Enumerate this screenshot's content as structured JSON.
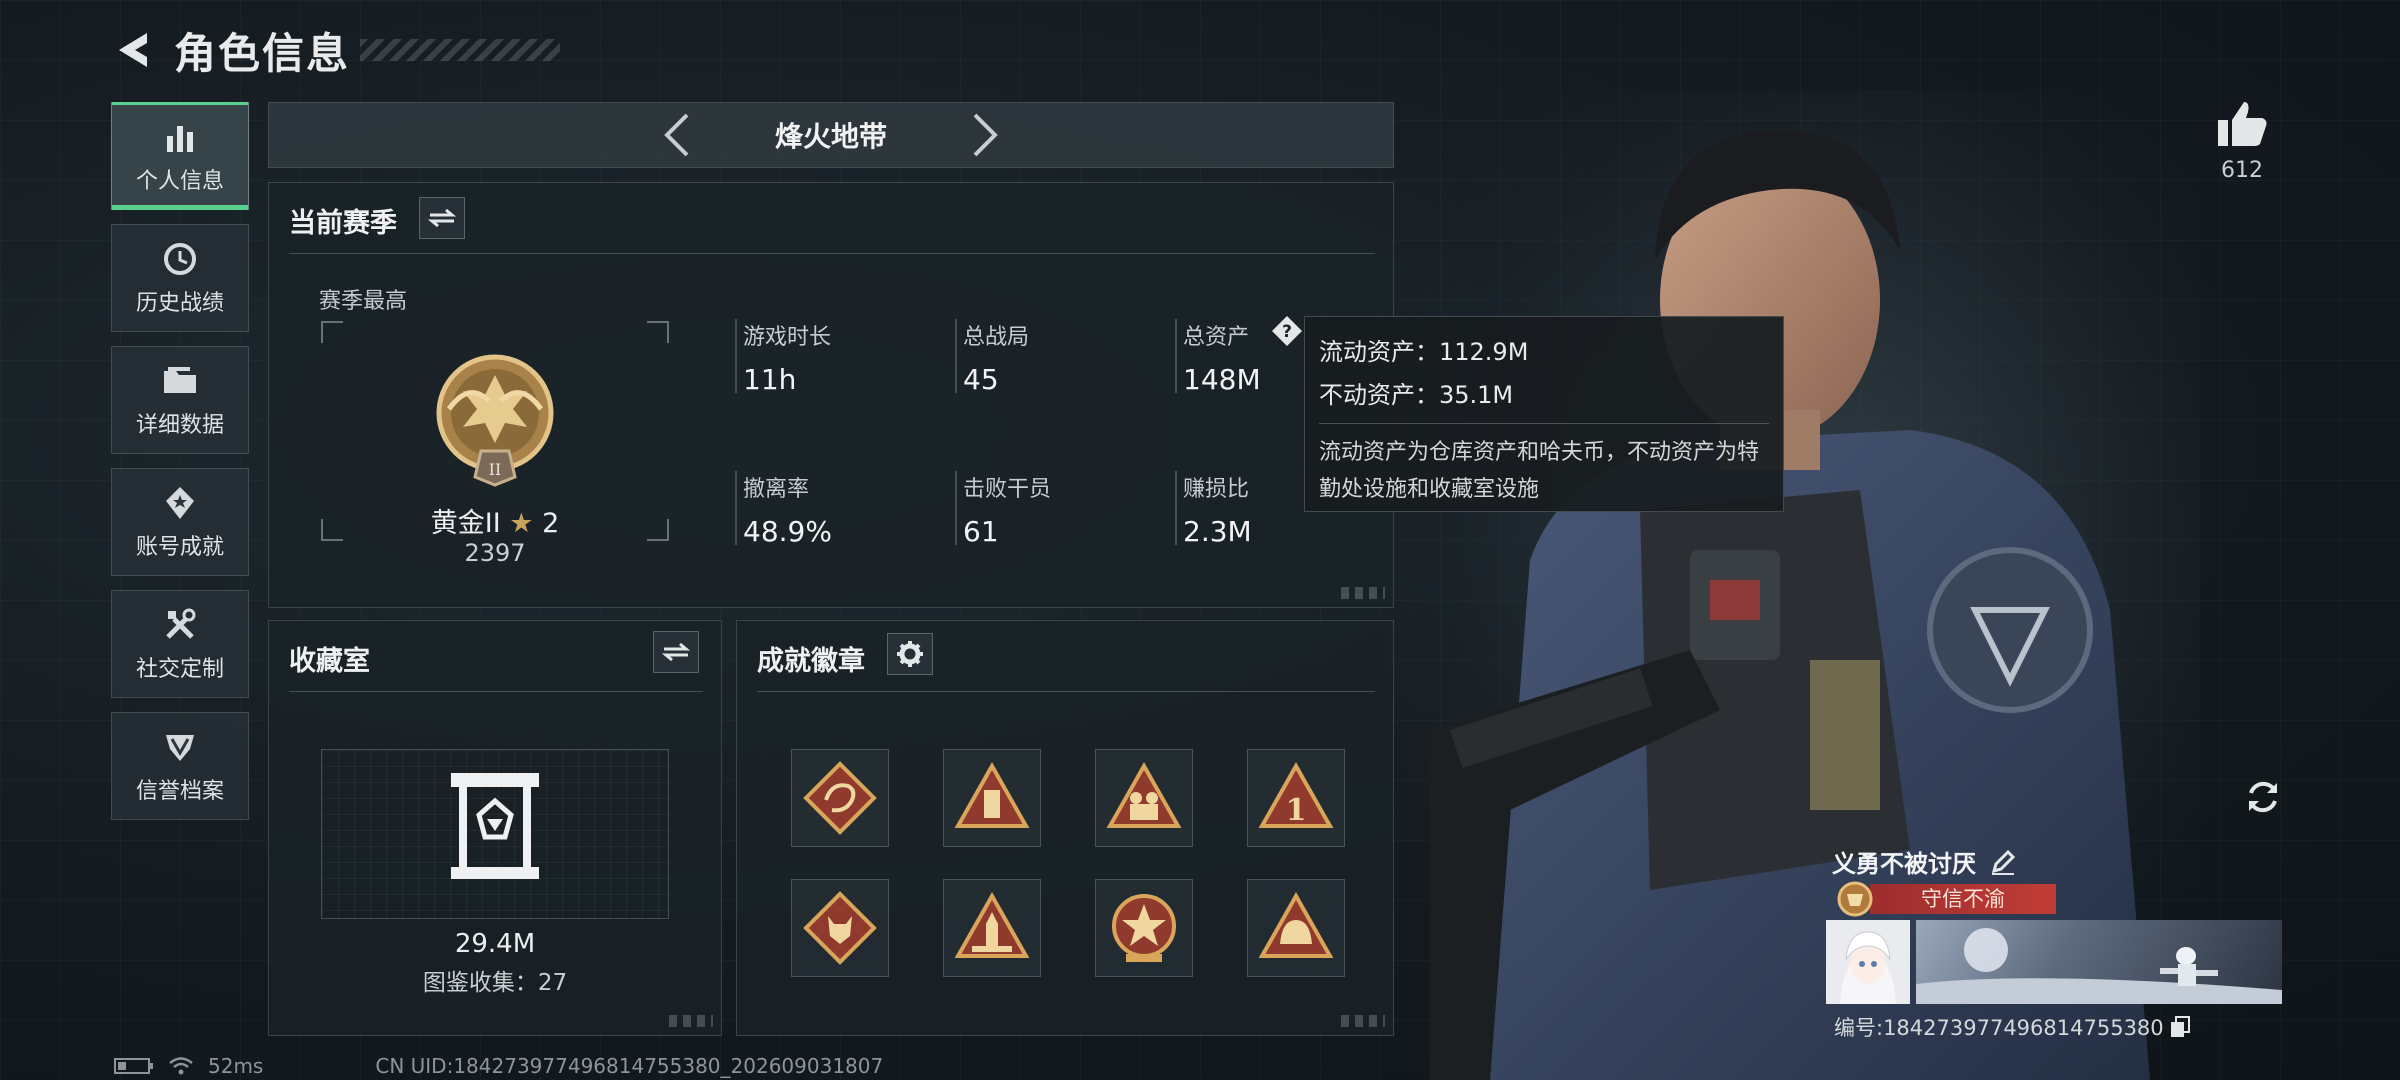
{
  "header": {
    "title": "角色信息"
  },
  "sidebar": {
    "items": [
      {
        "label": "个人信息",
        "icon": "bar-chart-icon",
        "active": true
      },
      {
        "label": "历史战绩",
        "icon": "history-clock-icon",
        "active": false
      },
      {
        "label": "详细数据",
        "icon": "folder-icon",
        "active": false
      },
      {
        "label": "账号成就",
        "icon": "achievement-badge-icon",
        "active": false
      },
      {
        "label": "社交定制",
        "icon": "tools-icon",
        "active": false
      },
      {
        "label": "信誉档案",
        "icon": "credit-shield-icon",
        "active": false
      }
    ]
  },
  "mode": {
    "name": "烽火地带"
  },
  "season": {
    "title": "当前赛季",
    "best_label": "赛季最高",
    "rank_name": "黄金II",
    "rank_stars": "2",
    "rank_score": "2397",
    "stats": [
      {
        "label": "游戏时长",
        "value": "11h"
      },
      {
        "label": "总战局",
        "value": "45"
      },
      {
        "label": "总资产",
        "value": "148M"
      },
      {
        "label": "撤离率",
        "value": "48.9%"
      },
      {
        "label": "击败干员",
        "value": "61"
      },
      {
        "label": "赚损比",
        "value": "2.3M"
      }
    ]
  },
  "tooltip": {
    "liquid": "流动资产：112.9M",
    "fixed": "不动资产：35.1M",
    "note": "流动资产为仓库资产和哈夫币，不动资产为特勤处设施和收藏室设施"
  },
  "collection": {
    "title": "收藏室",
    "value": "29.4M",
    "count_text": "图鉴收集：27"
  },
  "achievements": {
    "title": "成就徽章",
    "badges": [
      "dragon-badge",
      "tower-badge",
      "soldiers-badge",
      "number-one-badge",
      "wolf-badge",
      "rocket-badge",
      "star-emblem-badge",
      "helmet-badge"
    ]
  },
  "profile": {
    "like_count": "612",
    "player_name": "义勇不被讨厌",
    "title_tag": "守信不渝",
    "player_id": "编号:1842739774968147553​80"
  },
  "footer": {
    "ping": "52ms",
    "uid": "CN UID:1842739774968147553​80_202609031807"
  },
  "colors": {
    "accent_green": "#5bd18f",
    "title_red": "#b5352f",
    "gold": "#c9a35a"
  }
}
